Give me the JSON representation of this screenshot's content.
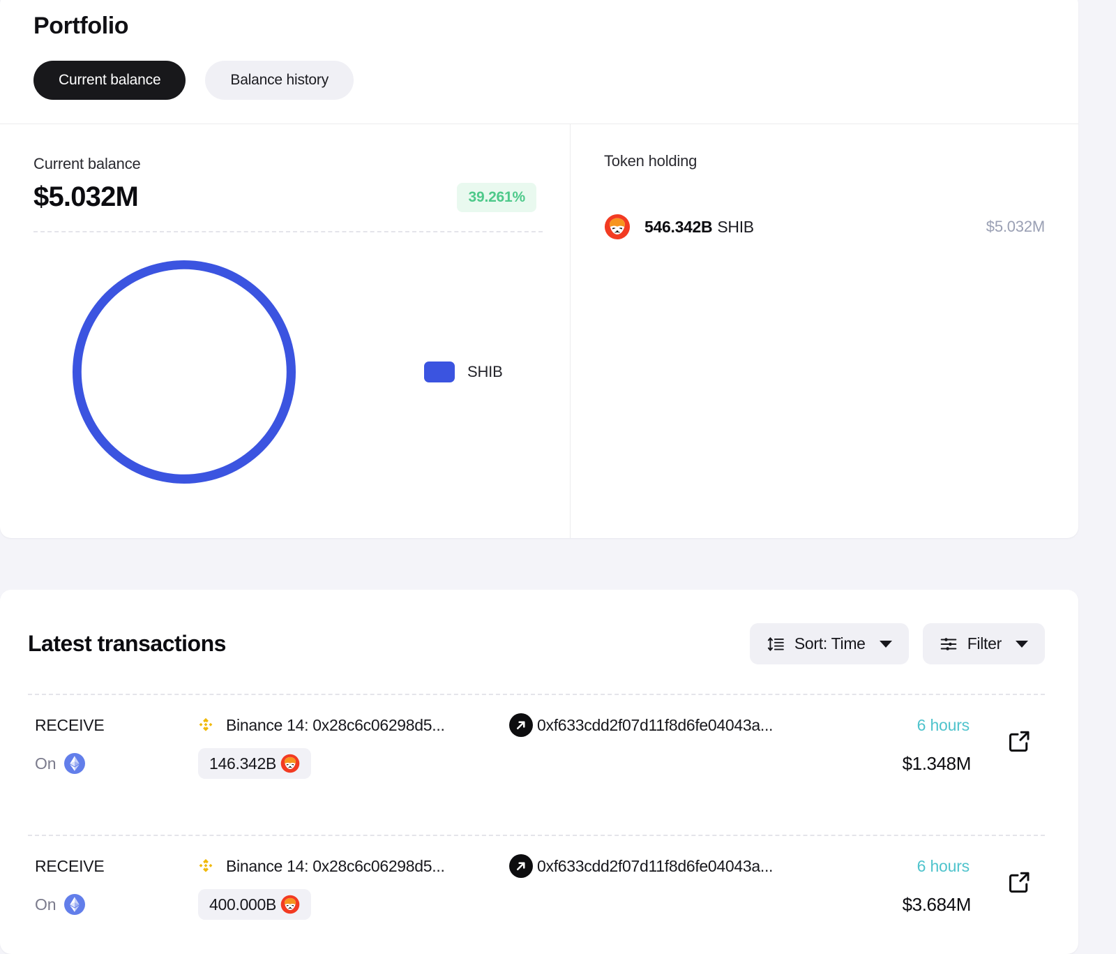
{
  "header": {
    "title": "Portfolio",
    "tabs": [
      {
        "label": "Current balance",
        "active": true
      },
      {
        "label": "Balance history",
        "active": false
      }
    ]
  },
  "balance": {
    "label": "Current balance",
    "amount": "$5.032M",
    "change_pct": "39.261%",
    "change_color": "#4ec98a"
  },
  "chart_data": {
    "type": "pie",
    "title": "",
    "categories": [
      "SHIB"
    ],
    "values": [
      100
    ],
    "value_unit": "%",
    "colors": [
      "#3b54e0"
    ],
    "legend": [
      "SHIB"
    ],
    "legend_position": "right",
    "donut": true,
    "inner_radius_ratio": 0.46,
    "total_usd": "$5.032M"
  },
  "token_holding": {
    "label": "Token holding",
    "rows": [
      {
        "icon": "shib-icon",
        "amount": "546.342B",
        "symbol": "SHIB",
        "value": "$5.032M"
      }
    ]
  },
  "transactions": {
    "title": "Latest transactions",
    "sort_label": "Sort: Time",
    "filter_label": "Filter",
    "rows": [
      {
        "type": "RECEIVE",
        "on_label": "On",
        "chain_icon": "ethereum-icon",
        "from_icon": "binance-icon",
        "from": "Binance 14: 0x28c6c06298d5...",
        "to": "0xf633cdd2f07d11f8d6fe04043a...",
        "amount": "146.342B",
        "amount_icon": "shib-icon",
        "time": "6 hours",
        "usd": "$1.348M"
      },
      {
        "type": "RECEIVE",
        "on_label": "On",
        "chain_icon": "ethereum-icon",
        "from_icon": "binance-icon",
        "from": "Binance 14: 0x28c6c06298d5...",
        "to": "0xf633cdd2f07d11f8d6fe04043a...",
        "amount": "400.000B",
        "amount_icon": "shib-icon",
        "time": "6 hours",
        "usd": "$3.684M"
      }
    ]
  }
}
